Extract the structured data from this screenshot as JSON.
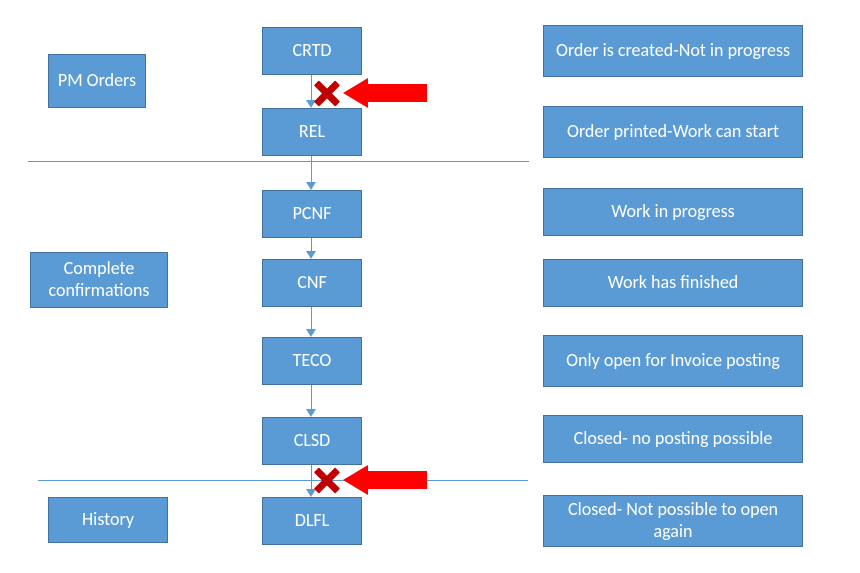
{
  "sideLabels": {
    "pmOrders": "PM Orders",
    "completeConfirmations": "Complete confirmations",
    "history": "History"
  },
  "flow": {
    "crtd": "CRTD",
    "rel": "REL",
    "pcnf": "PCNF",
    "cnf": "CNF",
    "teco": "TECO",
    "clsd": "CLSD",
    "dlfl": "DLFL"
  },
  "descriptions": {
    "crtd": "Order is created-Not in progress",
    "rel": "Order printed-Work can start",
    "pcnf": "Work in progress",
    "cnf": "Work has finished",
    "teco": "Only open for Invoice posting",
    "clsd": "Closed- no posting possible",
    "dlfl": "Closed- Not possible to open again"
  },
  "theme": {
    "boxFill": "#5B9BD5",
    "boxBorder": "#41719C",
    "arrowRed": "#FF0000",
    "xRed": "#C00000"
  }
}
